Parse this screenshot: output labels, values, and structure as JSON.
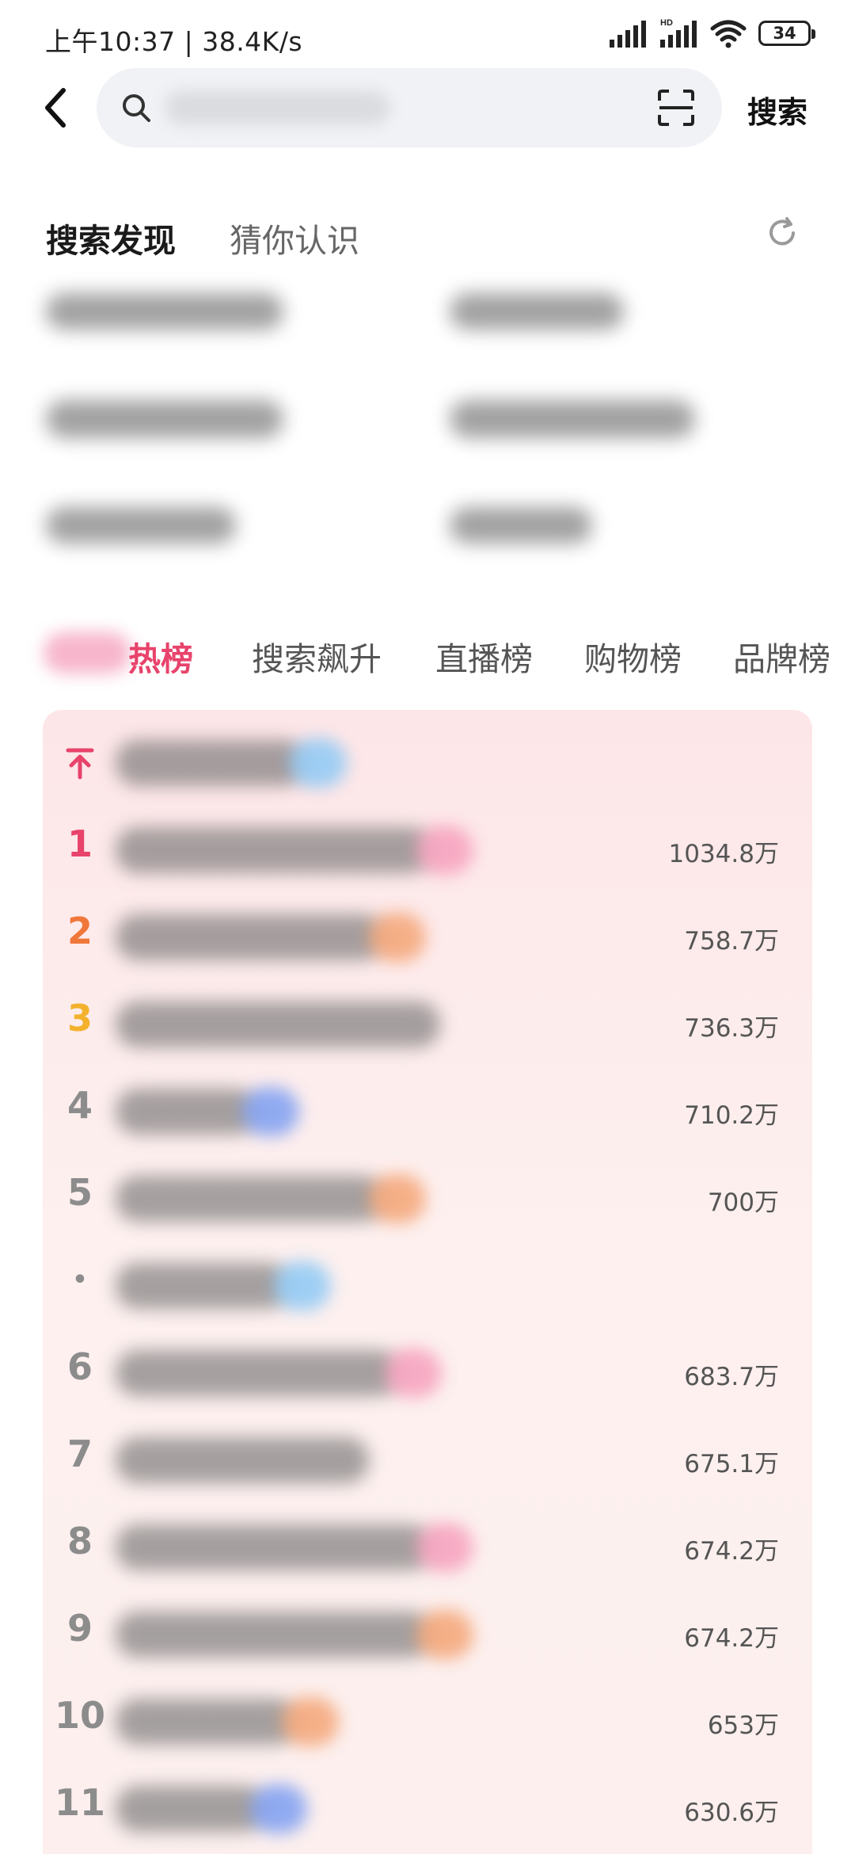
{
  "status_bar": {
    "time_speed": "上午10:37 | 38.4K/s",
    "battery": "34",
    "hd_label": "HD"
  },
  "header": {
    "search_button": "搜索"
  },
  "discover": {
    "tabs": [
      "搜索发现",
      "猜你认识"
    ]
  },
  "rank_tabs": [
    "热榜",
    "搜索飙升",
    "直播榜",
    "购物榜",
    "品牌榜"
  ],
  "hot_list": [
    {
      "rank": "pin",
      "count": "",
      "tag": "#8ec9f5"
    },
    {
      "rank": "1",
      "count": "1034.8万",
      "tag": "#f6a0bd"
    },
    {
      "rank": "2",
      "count": "758.7万",
      "tag": "#f4a576"
    },
    {
      "rank": "3",
      "count": "736.3万",
      "tag": ""
    },
    {
      "rank": "4",
      "count": "710.2万",
      "tag": "#7e9ff2"
    },
    {
      "rank": "5",
      "count": "700万",
      "tag": "#f4a576"
    },
    {
      "rank": "•",
      "count": "",
      "tag": "#8ec9f5"
    },
    {
      "rank": "6",
      "count": "683.7万",
      "tag": "#f6a0bd"
    },
    {
      "rank": "7",
      "count": "675.1万",
      "tag": ""
    },
    {
      "rank": "8",
      "count": "674.2万",
      "tag": "#f6a0bd"
    },
    {
      "rank": "9",
      "count": "674.2万",
      "tag": "#f4a576"
    },
    {
      "rank": "10",
      "count": "653万",
      "tag": "#f4a576"
    },
    {
      "rank": "11",
      "count": "630.6万",
      "tag": "#7e9ff2"
    }
  ],
  "colors": {
    "accent": "#e8436b",
    "rank2": "#f0773a",
    "rank3": "#f3b12c",
    "card_bg": "#fdeeee"
  }
}
